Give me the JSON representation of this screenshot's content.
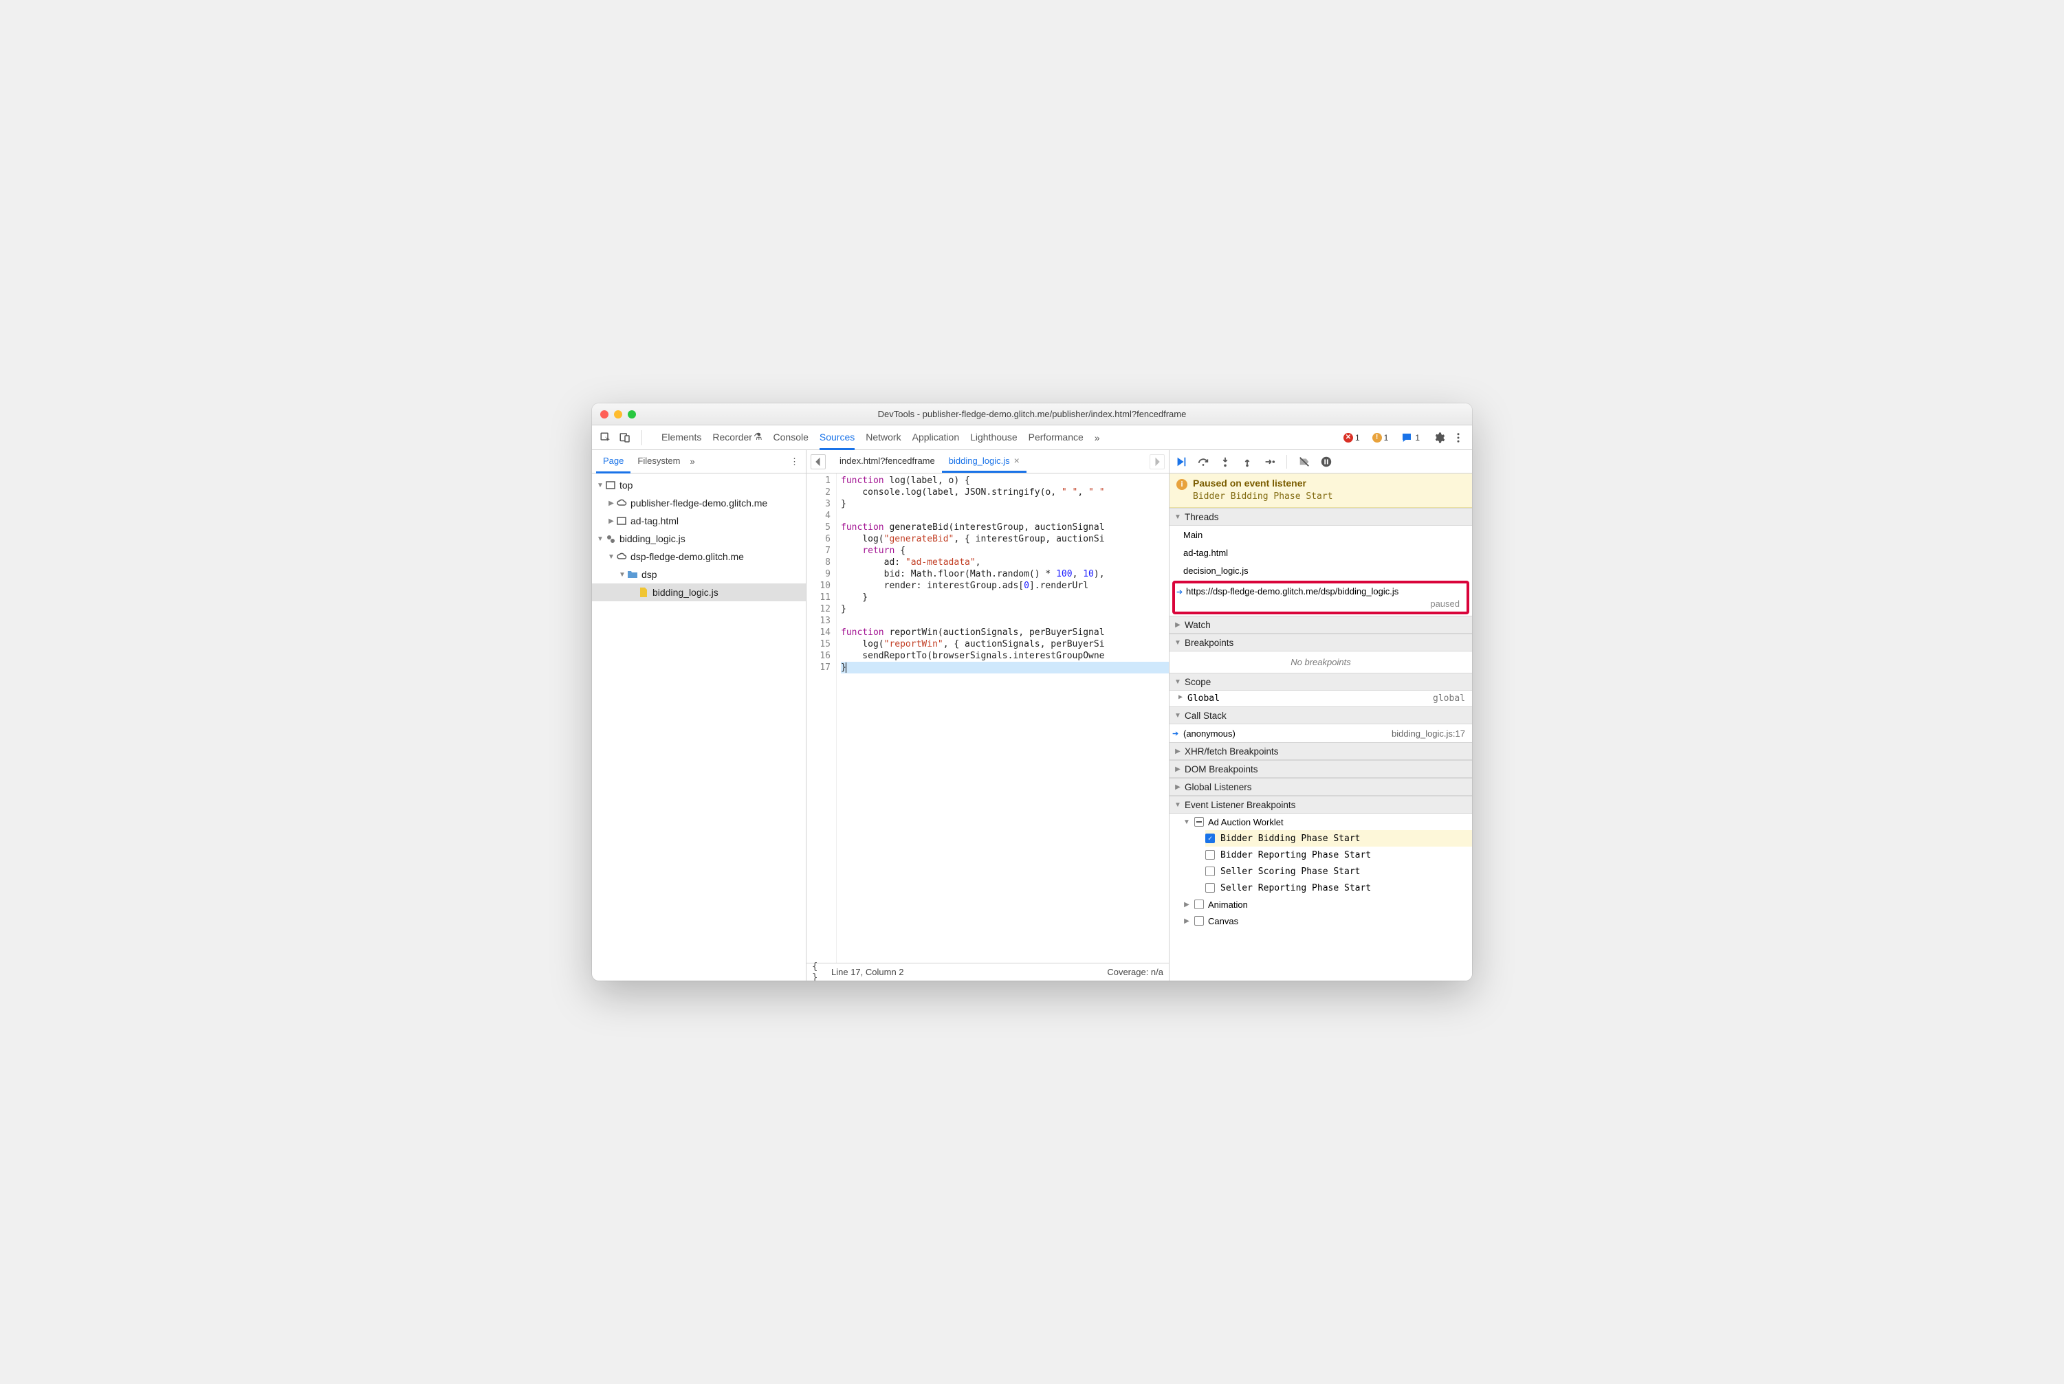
{
  "window": {
    "title": "DevTools - publisher-fledge-demo.glitch.me/publisher/index.html?fencedframe"
  },
  "toolbar": {
    "tabs": [
      "Elements",
      "Recorder",
      "Console",
      "Sources",
      "Network",
      "Application",
      "Lighthouse",
      "Performance"
    ],
    "active_tab": "Sources",
    "errors": "1",
    "warnings": "1",
    "issues": "1"
  },
  "left": {
    "subtabs": [
      "Page",
      "Filesystem"
    ],
    "active_subtab": "Page",
    "tree": {
      "top": "top",
      "host1": "publisher-fledge-demo.glitch.me",
      "adtag": "ad-tag.html",
      "worklet": "bidding_logic.js",
      "host2": "dsp-fledge-demo.glitch.me",
      "folder": "dsp",
      "file": "bidding_logic.js"
    }
  },
  "editor": {
    "tabs": [
      {
        "label": "index.html?fencedframe",
        "active": false,
        "closeable": false
      },
      {
        "label": "bidding_logic.js",
        "active": true,
        "closeable": true
      }
    ]
  },
  "code": {
    "lines": [
      {
        "n": "1",
        "seg": [
          {
            "t": "function ",
            "c": "kw"
          },
          {
            "t": "log(label, o) {"
          }
        ]
      },
      {
        "n": "2",
        "seg": [
          {
            "t": "    console.log(label, JSON.stringify(o, "
          },
          {
            "t": "\" \"",
            "c": "str"
          },
          {
            "t": ", "
          },
          {
            "t": "\" \"",
            "c": "str"
          }
        ]
      },
      {
        "n": "3",
        "seg": [
          {
            "t": "}"
          }
        ]
      },
      {
        "n": "4",
        "seg": []
      },
      {
        "n": "5",
        "seg": [
          {
            "t": "function ",
            "c": "kw"
          },
          {
            "t": "generateBid(interestGroup, auctionSignal"
          }
        ]
      },
      {
        "n": "6",
        "seg": [
          {
            "t": "    log("
          },
          {
            "t": "\"generateBid\"",
            "c": "str"
          },
          {
            "t": ", { interestGroup, auctionSi"
          }
        ]
      },
      {
        "n": "7",
        "seg": [
          {
            "t": "    "
          },
          {
            "t": "return",
            "c": "kw"
          },
          {
            "t": " {"
          }
        ]
      },
      {
        "n": "8",
        "seg": [
          {
            "t": "        ad: "
          },
          {
            "t": "\"ad-metadata\"",
            "c": "str"
          },
          {
            "t": ","
          }
        ]
      },
      {
        "n": "9",
        "seg": [
          {
            "t": "        bid: Math.floor(Math.random() * "
          },
          {
            "t": "100",
            "c": "num"
          },
          {
            "t": ", "
          },
          {
            "t": "10",
            "c": "num"
          },
          {
            "t": "),"
          }
        ]
      },
      {
        "n": "10",
        "seg": [
          {
            "t": "        render: interestGroup.ads["
          },
          {
            "t": "0",
            "c": "num"
          },
          {
            "t": "].renderUrl"
          }
        ]
      },
      {
        "n": "11",
        "seg": [
          {
            "t": "    }"
          }
        ]
      },
      {
        "n": "12",
        "seg": [
          {
            "t": "}"
          }
        ]
      },
      {
        "n": "13",
        "seg": []
      },
      {
        "n": "14",
        "seg": [
          {
            "t": "function ",
            "c": "kw"
          },
          {
            "t": "reportWin(auctionSignals, perBuyerSignal"
          }
        ]
      },
      {
        "n": "15",
        "seg": [
          {
            "t": "    log("
          },
          {
            "t": "\"reportWin\"",
            "c": "str"
          },
          {
            "t": ", { auctionSignals, perBuyerSi"
          }
        ]
      },
      {
        "n": "16",
        "seg": [
          {
            "t": "    sendReportTo(browserSignals.interestGroupOwne"
          }
        ]
      },
      {
        "n": "17",
        "seg": [
          {
            "t": "}"
          }
        ],
        "hl": true,
        "cursor": true
      }
    ]
  },
  "status": {
    "position": "Line 17, Column 2",
    "coverage": "Coverage: n/a"
  },
  "debugger": {
    "pause_title": "Paused on event listener",
    "pause_msg": "Bidder Bidding Phase Start",
    "sections": {
      "threads": "Threads",
      "watch": "Watch",
      "breakpoints": "Breakpoints",
      "scope": "Scope",
      "callstack": "Call Stack",
      "xhr": "XHR/fetch Breakpoints",
      "dom": "DOM Breakpoints",
      "global_listeners": "Global Listeners",
      "elb": "Event Listener Breakpoints"
    },
    "threads": {
      "items": [
        "Main",
        "ad-tag.html",
        "decision_logic.js"
      ],
      "active": "https://dsp-fledge-demo.glitch.me/dsp/bidding_logic.js",
      "paused_label": "paused"
    },
    "breakpoints_empty": "No breakpoints",
    "scope": {
      "global_label": "Global",
      "global_value": "global"
    },
    "callstack": {
      "frame": "(anonymous)",
      "loc": "bidding_logic.js:17"
    },
    "elb": {
      "group": "Ad Auction Worklet",
      "options": [
        {
          "label": "Bidder Bidding Phase Start",
          "checked": true,
          "hl": true
        },
        {
          "label": "Bidder Reporting Phase Start",
          "checked": false
        },
        {
          "label": "Seller Scoring Phase Start",
          "checked": false
        },
        {
          "label": "Seller Reporting Phase Start",
          "checked": false
        }
      ],
      "after": [
        "Animation",
        "Canvas"
      ]
    }
  }
}
